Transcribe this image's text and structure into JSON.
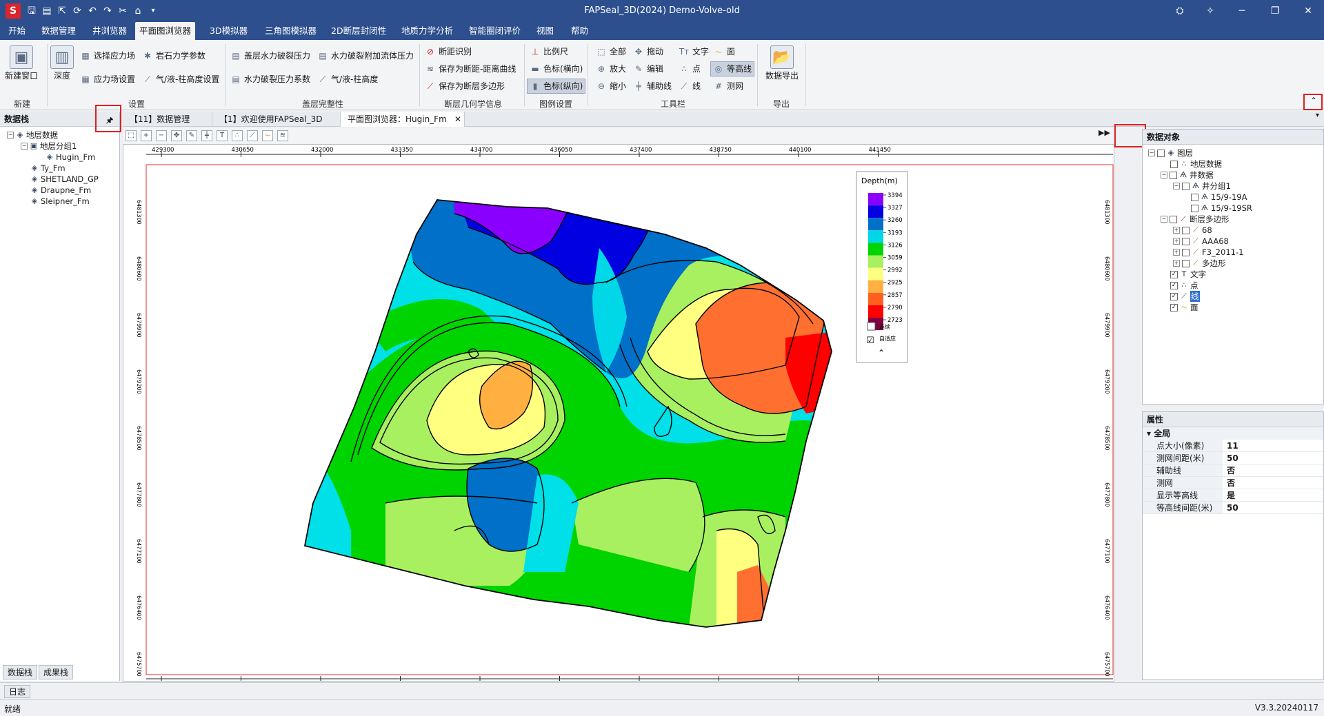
{
  "app": {
    "logo": "S",
    "title": "FAPSeal_3D(2024) Demo-Volve-old"
  },
  "quick_access": [
    "save-icon",
    "save-as-icon",
    "export-icon",
    "refresh-icon",
    "undo-icon",
    "redo-icon",
    "cut-icon",
    "home-icon",
    "dropdown-icon"
  ],
  "menu": [
    "开始",
    "数据管理",
    "井浏览器",
    "平面图浏览器",
    "3D模拟器",
    "三角图模拟器",
    "2D断层封闭性",
    "地质力学分析",
    "智能圈闭评价",
    "视图",
    "帮助"
  ],
  "menu_active": 3,
  "ribbon": {
    "new_window": "新建窗口",
    "depth": "深度",
    "select_stress": "选择应力场",
    "rock_params": "岩石力学参数",
    "stress_settings": "应力场设置",
    "gas_liquid_height": "气/液-柱高度设置",
    "caprock_frac": "盖层水力破裂压力",
    "hydrofrac_add": "水力破裂附加流体压力",
    "hydrofrac_coef": "水力破裂压力系数",
    "gas_liquid_col": "气/液-柱高度",
    "fault_detect": "断距识别",
    "save_dist_curve": "保存为断距-距离曲线",
    "save_fault_poly": "保存为断层多边形",
    "scale": "比例尺",
    "colorbar_h": "色标(横向)",
    "colorbar_v": "色标(纵向)",
    "all": "全部",
    "drag": "拖动",
    "text": "文字",
    "face": "面",
    "zoom_in": "放大",
    "edit": "编辑",
    "point": "点",
    "contour": "等高线",
    "zoom_out": "缩小",
    "aux_line": "辅助线",
    "line": "线",
    "mesh": "测网",
    "data_export": "数据导出",
    "groups": {
      "new": "新建",
      "settings": "设置",
      "caprock": "盖层完整性",
      "fault_geom": "断层几何学信息",
      "legend": "图例设置",
      "toolbar": "工具栏",
      "export": "导出"
    }
  },
  "left_panel": {
    "title": "数据栈",
    "pin": "🖈",
    "root": "地层数据",
    "group": "地层分组1",
    "child": "Hugin_Fm",
    "items": [
      "Ty_Fm",
      "SHETLAND_GP",
      "Draupne_Fm",
      "Sleipner_Fm"
    ],
    "tabs": [
      "数据栈",
      "成果栈"
    ]
  },
  "doc_tabs": [
    "【11】数据管理",
    "【1】欢迎使用FAPSeal_3D",
    "平面图浏览器：Hugin_Fm"
  ],
  "doc_tab_close": "✕",
  "map": {
    "x_ticks": [
      "429300",
      "430650",
      "432000",
      "433350",
      "434700",
      "436050",
      "437400",
      "438750",
      "440100",
      "441450"
    ],
    "y_ticks": [
      "6481300",
      "6480600",
      "6479900",
      "6479200",
      "6478500",
      "6477800",
      "6477100",
      "6476400",
      "6475700"
    ],
    "legend_title": "Depth(m)",
    "legend_values": [
      "3394",
      "3327",
      "3260",
      "3193",
      "3126",
      "3059",
      "2992",
      "2925",
      "2857",
      "2790",
      "2723"
    ],
    "legend_colors": [
      "#8a00ff",
      "#0000e0",
      "#0070c8",
      "#00d8e8",
      "#00d400",
      "#a8f060",
      "#ffff80",
      "#ffb040",
      "#ff6020",
      "#ff0000",
      "#800040"
    ],
    "legend_check1": "连续",
    "legend_check2": "自适应",
    "legend_check2_state": "☑",
    "legend_collapse": "⌃",
    "expand_arrow": "▶▶"
  },
  "data_objects": {
    "title": "数据对象",
    "layer": "图层",
    "strata": "地层数据",
    "well_data": "井数据",
    "well_group": "井分组1",
    "wells": [
      "15/9-19A",
      "15/9-19SR"
    ],
    "fault_poly": "断层多边形",
    "faults": [
      "68",
      "AAA68",
      "F3_2011-1",
      "多边形"
    ],
    "text": "文字",
    "point": "点",
    "line": "线",
    "face": "面"
  },
  "properties": {
    "title": "属性",
    "section": "全局",
    "rows": [
      {
        "k": "点大小(像素)",
        "v": "11"
      },
      {
        "k": "测网间距(米)",
        "v": "50"
      },
      {
        "k": "辅助线",
        "v": "否"
      },
      {
        "k": "测网",
        "v": "否"
      },
      {
        "k": "显示等高线",
        "v": "是"
      },
      {
        "k": "等高线间距(米)",
        "v": "50"
      }
    ]
  },
  "log_tab": "日志",
  "status": {
    "left": "就绪",
    "version": "V3.3.20240117"
  }
}
